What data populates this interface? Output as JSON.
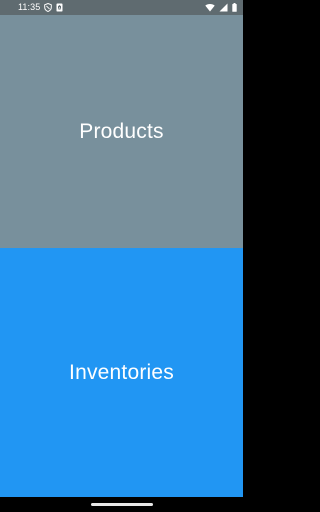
{
  "status_bar": {
    "time": "11:35",
    "left_icons": [
      "shield-icon",
      "sim-card-icon"
    ],
    "right_icons": [
      "wifi-icon",
      "signal-icon",
      "battery-icon"
    ],
    "background": "#5f6b70"
  },
  "tiles": [
    {
      "label": "Products",
      "color": "#78909c"
    },
    {
      "label": "Inventories",
      "color": "#2196f3"
    }
  ],
  "nav_bar": {
    "background": "#000000"
  }
}
